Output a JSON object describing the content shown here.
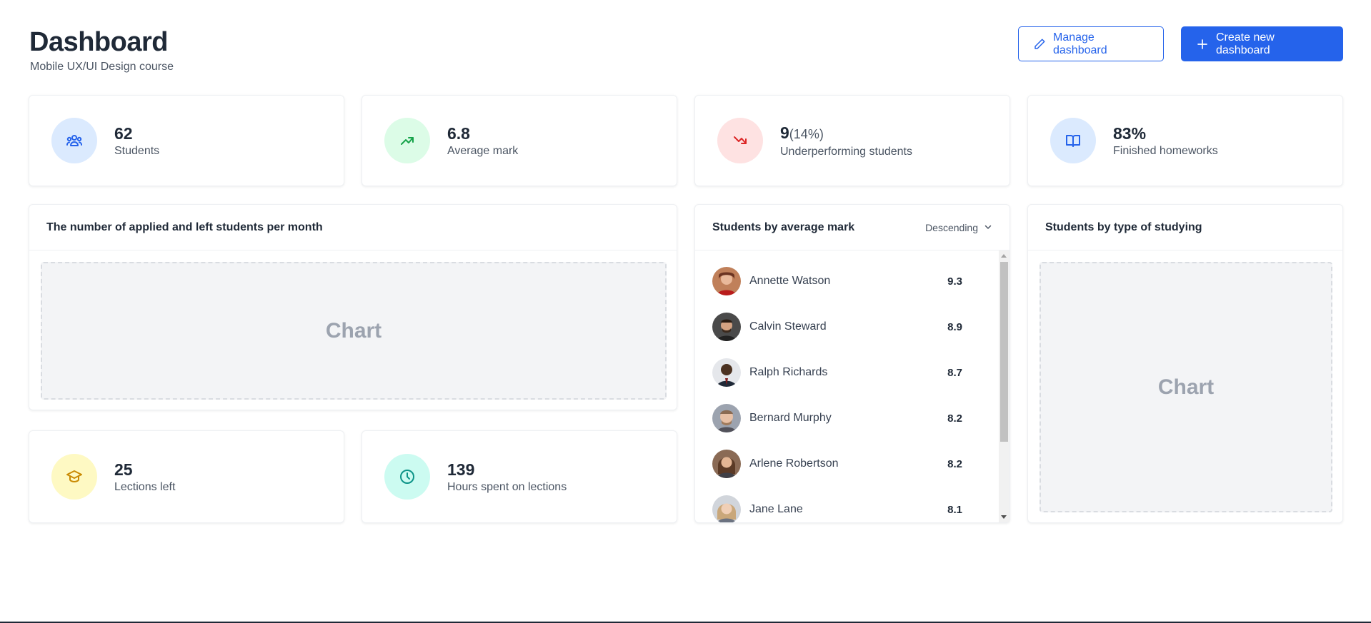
{
  "header": {
    "title": "Dashboard",
    "subtitle": "Mobile UX/UI Design course",
    "manage_label": "Manage dashboard",
    "create_label": "Create new dashboard"
  },
  "stats": [
    {
      "value": "62",
      "label": "Students",
      "icon": "users-icon",
      "icon_bg": "#dbeafe",
      "icon_color": "#2563eb"
    },
    {
      "value": "6.8",
      "label": "Average mark",
      "icon": "trending-up-icon",
      "icon_bg": "#dcfce7",
      "icon_color": "#16a34a"
    },
    {
      "value": "9",
      "value_sub": "(14%)",
      "label": "Underperforming students",
      "icon": "trending-down-icon",
      "icon_bg": "#fee2e2",
      "icon_color": "#dc2626"
    },
    {
      "value": "83%",
      "label": "Finished homeworks",
      "icon": "book-open-icon",
      "icon_bg": "#dbeafe",
      "icon_color": "#2563eb"
    },
    {
      "value": "25",
      "label": "Lections left",
      "icon": "graduation-cap-icon",
      "icon_bg": "#fef9c3",
      "icon_color": "#ca8a04"
    },
    {
      "value": "139",
      "label": "Hours spent on lections",
      "icon": "clock-icon",
      "icon_bg": "#ccfbf1",
      "icon_color": "#0d9488"
    }
  ],
  "applied_chart": {
    "title": "The number of applied and left students per month",
    "placeholder": "Chart"
  },
  "mark_list": {
    "title": "Students by average mark",
    "sort_label": "Descending",
    "students": [
      {
        "name": "Annette Watson",
        "mark": "9.3"
      },
      {
        "name": "Calvin Steward",
        "mark": "8.9"
      },
      {
        "name": "Ralph Richards",
        "mark": "8.7"
      },
      {
        "name": "Bernard Murphy",
        "mark": "8.2"
      },
      {
        "name": "Arlene Robertson",
        "mark": "8.2"
      },
      {
        "name": "Jane Lane",
        "mark": "8.1"
      }
    ]
  },
  "type_chart": {
    "title": "Students by type of studying",
    "placeholder": "Chart"
  },
  "colors": {
    "accent": "#2563eb"
  }
}
